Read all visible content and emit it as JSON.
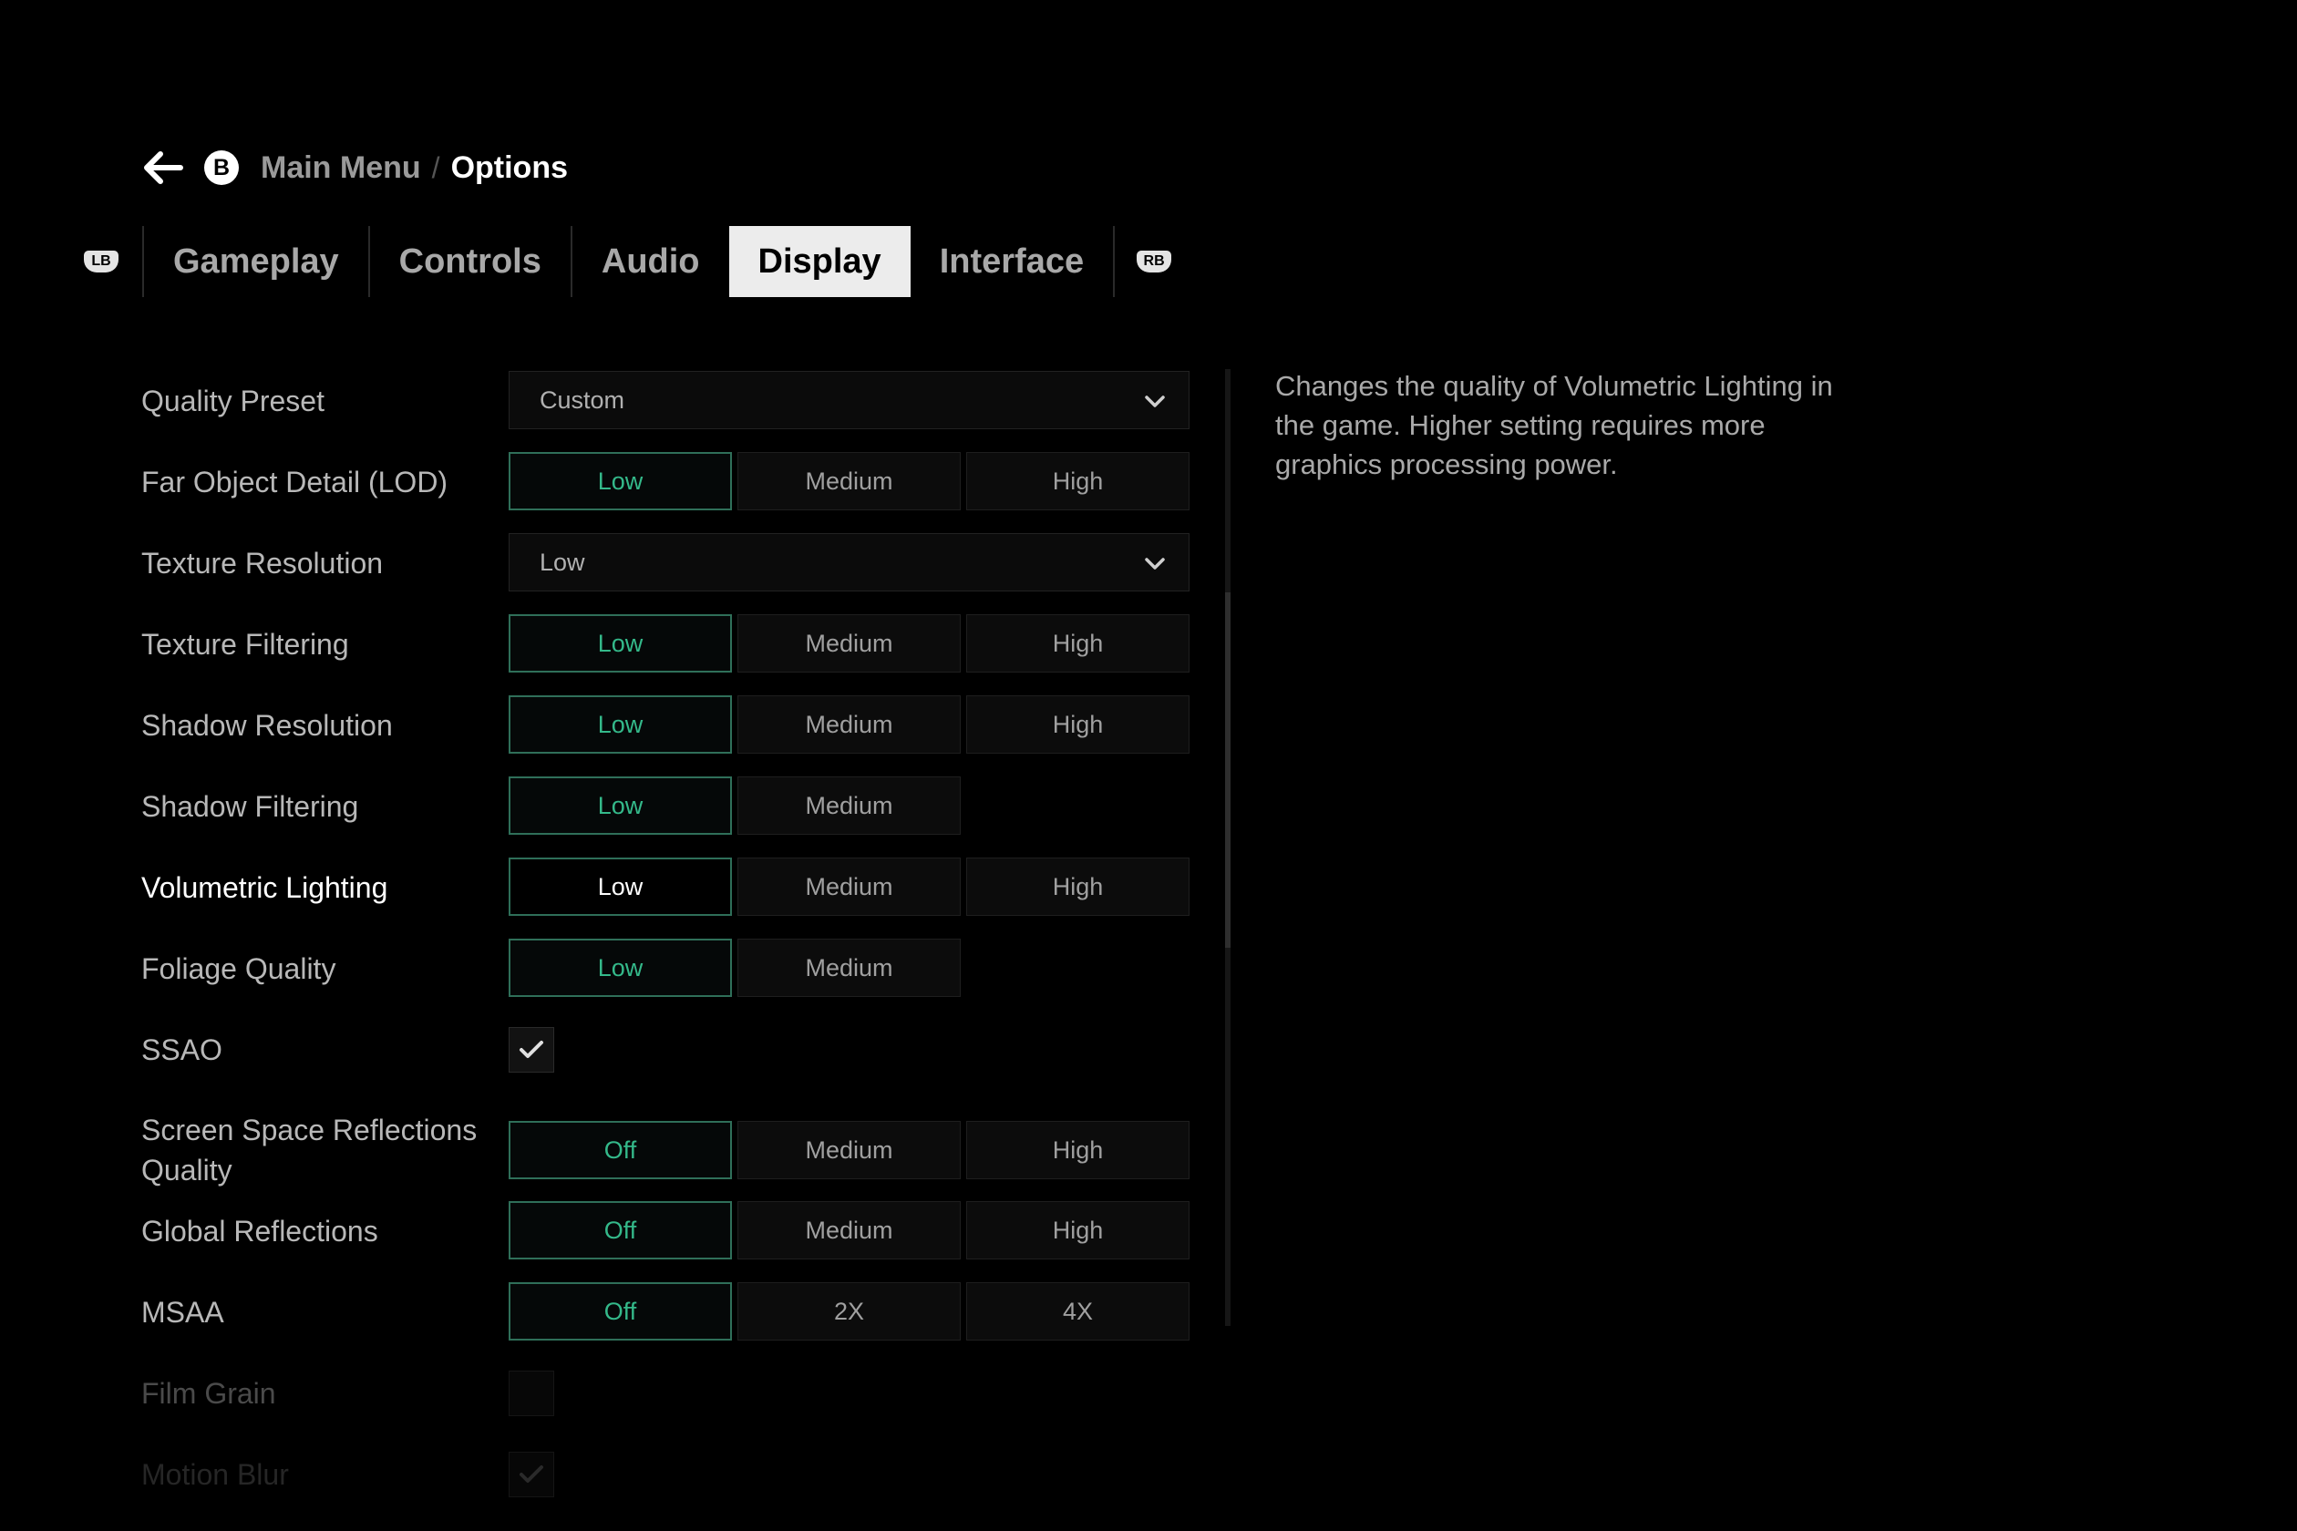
{
  "header": {
    "back_button_glyph": "B",
    "breadcrumb_parent": "Main Menu",
    "breadcrumb_separator": "/",
    "breadcrumb_current": "Options"
  },
  "tabs": {
    "left_bumper": "LB",
    "right_bumper": "RB",
    "items": [
      {
        "label": "Gameplay"
      },
      {
        "label": "Controls"
      },
      {
        "label": "Audio"
      },
      {
        "label": "Display",
        "active": true
      },
      {
        "label": "Interface"
      }
    ]
  },
  "settings": {
    "quality_preset": {
      "label": "Quality Preset",
      "value": "Custom"
    },
    "far_object_detail": {
      "label": "Far Object Detail (LOD)",
      "options": [
        "Low",
        "Medium",
        "High"
      ],
      "selected": "Low"
    },
    "texture_resolution": {
      "label": "Texture Resolution",
      "value": "Low"
    },
    "texture_filtering": {
      "label": "Texture Filtering",
      "options": [
        "Low",
        "Medium",
        "High"
      ],
      "selected": "Low"
    },
    "shadow_resolution": {
      "label": "Shadow Resolution",
      "options": [
        "Low",
        "Medium",
        "High"
      ],
      "selected": "Low"
    },
    "shadow_filtering": {
      "label": "Shadow Filtering",
      "options": [
        "Low",
        "Medium"
      ],
      "selected": "Low"
    },
    "volumetric_lighting": {
      "label": "Volumetric Lighting",
      "options": [
        "Low",
        "Medium",
        "High"
      ],
      "selected": "Low",
      "focused": true
    },
    "foliage_quality": {
      "label": "Foliage Quality",
      "options": [
        "Low",
        "Medium"
      ],
      "selected": "Low"
    },
    "ssao": {
      "label": "SSAO",
      "checked": true
    },
    "ssr_quality": {
      "label": "Screen Space Reflections Quality",
      "options": [
        "Off",
        "Medium",
        "High"
      ],
      "selected": "Off"
    },
    "global_reflections": {
      "label": "Global Reflections",
      "options": [
        "Off",
        "Medium",
        "High"
      ],
      "selected": "Off"
    },
    "msaa": {
      "label": "MSAA",
      "options": [
        "Off",
        "2X",
        "4X"
      ],
      "selected": "Off"
    },
    "film_grain": {
      "label": "Film Grain",
      "checked": false
    },
    "motion_blur": {
      "label": "Motion Blur",
      "checked": true
    }
  },
  "description": "Changes the quality of Volumetric Lighting in the game. Higher setting requires more graphics processing power.",
  "colors": {
    "accent_selected": "#34b98a",
    "accent_border": "#2f6f59",
    "active_tab_bg": "#ececec",
    "background": "#000000"
  },
  "icons": {
    "back": "back-arrow-icon",
    "dropdown": "chevron-down-icon",
    "check": "check-icon"
  }
}
